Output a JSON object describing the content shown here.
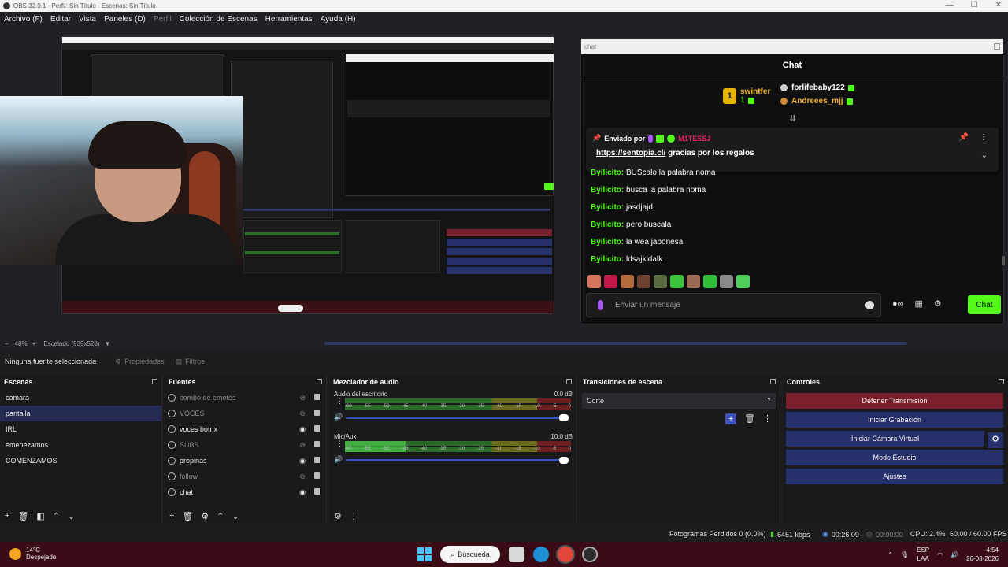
{
  "window": {
    "title": "OBS 32.0.1 - Perfil: Sin Título - Escenas: Sin Título",
    "controls": [
      "—",
      "☐",
      "✕"
    ]
  },
  "menu": [
    "Archivo (F)",
    "Editar",
    "Vista",
    "Paneles (D)",
    "Perfil",
    "Colección de Escenas",
    "Herramientas",
    "Ayuda (H)"
  ],
  "chat_dock": {
    "dock_title": "chat",
    "header": "Chat",
    "leaderboard": {
      "rank": "1",
      "top_user": "swintfer",
      "top_count": "1",
      "others": [
        {
          "name": "forlifebaby122",
          "color": "#ffffff"
        },
        {
          "name": "Andreees_mjj",
          "color": "#f2b233"
        }
      ]
    },
    "pinned": {
      "sent_by": "Enviado por",
      "user": "M1TESSJ",
      "link": "https://sentopia.cl/",
      "text": " gracias por los regalos"
    },
    "messages": [
      {
        "user": "Byilicito:",
        "text": " BUScalo la palabra noma"
      },
      {
        "user": "Byilicito:",
        "text": " busca la palabra noma"
      },
      {
        "user": "Byilicito:",
        "text": " jasdjajd"
      },
      {
        "user": "Byilicito:",
        "text": " pero buscala"
      },
      {
        "user": "Byilicito:",
        "text": " la wea japonesa"
      },
      {
        "user": "Byilicito:",
        "text": " ldsajkldalk"
      }
    ],
    "input_placeholder": "Enviar un mensaje",
    "send_label": "Chat",
    "accent": "#53fc18"
  },
  "preview": {
    "zoom": "48%",
    "scale": "Escalado (939x528)"
  },
  "source_bar": {
    "no_source": "Ninguna fuente seleccionada",
    "properties": "Propiedades",
    "filters": "Filtros"
  },
  "scenes": {
    "title": "Escenas",
    "items": [
      "camara",
      "pantalla",
      "IRL",
      "emepezamos",
      "COMENZAMOS"
    ],
    "active": "pantalla"
  },
  "sources": {
    "title": "Fuentes",
    "items": [
      {
        "name": "combo de emotes",
        "visible": false
      },
      {
        "name": "VOCES",
        "visible": false
      },
      {
        "name": "voces botrix",
        "visible": true
      },
      {
        "name": "SUBS",
        "visible": false
      },
      {
        "name": "propinas",
        "visible": true
      },
      {
        "name": "follow",
        "visible": false
      },
      {
        "name": "chat",
        "visible": true
      }
    ]
  },
  "mixer": {
    "title": "Mezclador de audio",
    "ticks": [
      "-60",
      "-55",
      "-50",
      "-45",
      "-40",
      "-35",
      "-30",
      "-25",
      "-20",
      "-15",
      "-10",
      "-5",
      "0"
    ],
    "channels": [
      {
        "name": "Audio del escritorio",
        "db": "0.0 dB",
        "level": 0.0
      },
      {
        "name": "Mic/Aux",
        "db": "10.0 dB",
        "level": 0.27
      }
    ]
  },
  "transitions": {
    "title": "Transiciones de escena",
    "selected": "Corte"
  },
  "controls": {
    "title": "Controles",
    "buttons": [
      {
        "label": "Detener Transmisión",
        "color": "#7a1f2e"
      },
      {
        "label": "Iniciar Grabación",
        "color": "#26306a"
      },
      {
        "label": "Iniciar Cámara Virtual",
        "color": "#26306a"
      },
      {
        "label": "Modo Estudio",
        "color": "#26306a"
      },
      {
        "label": "Ajustes",
        "color": "#26306a"
      }
    ]
  },
  "status": {
    "dropped": "Fotogramas Perdidos 0 (0.0%)",
    "bitrate": "6451 kbps",
    "stream_time": "00:26:09",
    "rec_time": "00:00:00",
    "cpu": "CPU: 2.4%",
    "fps": "60.00 / 60.00 FPS"
  },
  "taskbar": {
    "temp": "14°C",
    "weather": "Despejado",
    "search": "Búsqueda",
    "lang": "ESP",
    "region": "LAA",
    "time": "4:54",
    "date": "26-03-2026"
  }
}
